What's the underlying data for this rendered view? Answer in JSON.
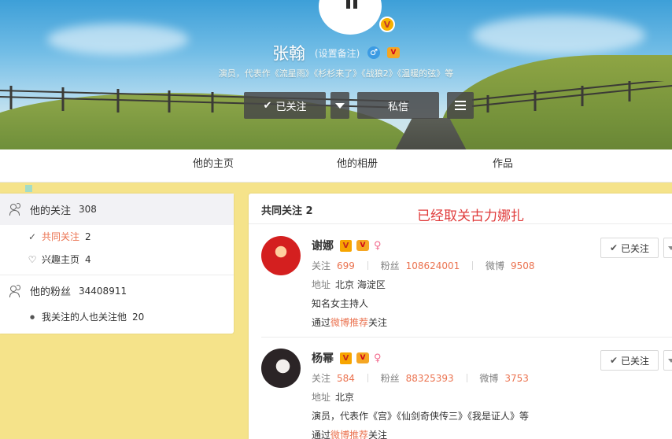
{
  "profile": {
    "name": "张翰",
    "remark_link": "(设置备注)",
    "gender_symbol": "♂",
    "vip_badge": "V",
    "bio": "演员，代表作《流星雨》《杉杉来了》《战狼2》《温暖的弦》等"
  },
  "actions": {
    "followed_label": "已关注",
    "message_label": "私信"
  },
  "icons": {
    "check": "✔",
    "check_small": "✓",
    "heart": "♡",
    "dot": "●",
    "female": "♀",
    "v": "V",
    "vip": "V"
  },
  "tabs": [
    {
      "label": "他的主页"
    },
    {
      "label": "他的相册"
    },
    {
      "label": "作品"
    }
  ],
  "sidebar": {
    "following": {
      "label": "他的关注",
      "count": "308"
    },
    "mutual": {
      "label": "共同关注",
      "count": "2"
    },
    "interests": {
      "label": "兴趣主页",
      "count": "4"
    },
    "fans": {
      "label": "他的粉丝",
      "count": "34408911"
    },
    "also_follow": {
      "label": "我关注的人也关注他",
      "count": "20"
    }
  },
  "panel": {
    "title": "共同关注 2",
    "annotation": "已经取关古力娜扎"
  },
  "users": [
    {
      "name": "谢娜",
      "following_label": "关注",
      "following": "699",
      "fans_label": "粉丝",
      "fans": "108624001",
      "weibo_label": "微博",
      "weibo": "9508",
      "address_label": "地址",
      "address": "北京 海淀区",
      "description": "知名女主持人",
      "via_prefix": "通过",
      "via_link": "微博推荐",
      "via_suffix": "关注",
      "button_label": "已关注"
    },
    {
      "name": "杨幂",
      "following_label": "关注",
      "following": "584",
      "fans_label": "粉丝",
      "fans": "88325393",
      "weibo_label": "微博",
      "weibo": "3753",
      "address_label": "地址",
      "address": "北京",
      "description": "演员，代表作《宫》《仙剑奇侠传三》《我是证人》等",
      "via_prefix": "通过",
      "via_link": "微博推荐",
      "via_suffix": "关注",
      "button_label": "已关注"
    }
  ],
  "colors": {
    "accent_orange": "#eb7350",
    "annotation_red": "#e03b3b",
    "page_yellow": "#f5e38a",
    "header_button": "#484848"
  }
}
